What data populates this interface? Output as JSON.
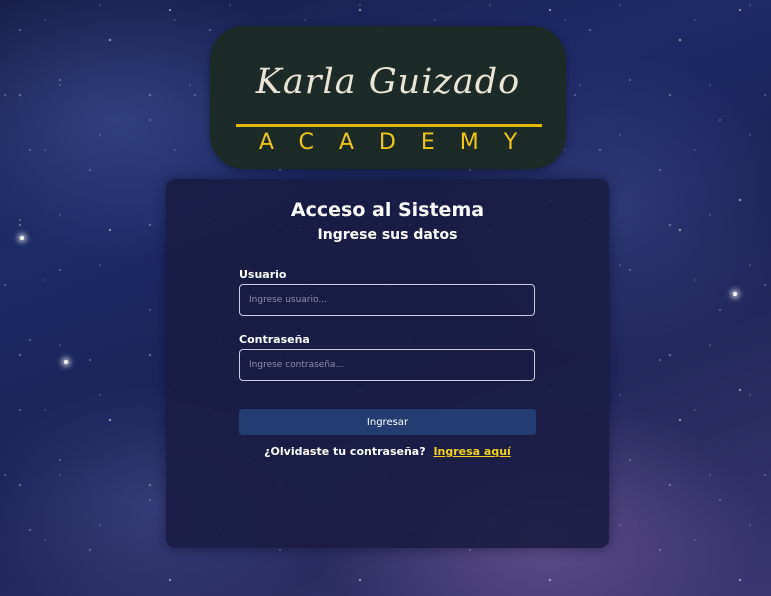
{
  "logo": {
    "script_text": "Karla Guizado",
    "subtitle_text": "ACADEMY",
    "background_color": "#1d2b28",
    "accent_color": "#f0c419"
  },
  "login": {
    "title": "Acceso al Sistema",
    "subtitle": "Ingrese sus datos",
    "username_label": "Usuario",
    "username_placeholder": "Ingrese usuario...",
    "username_value": "",
    "password_label": "Contraseña",
    "password_placeholder": "Ingrese contraseña...",
    "password_value": "",
    "submit_label": "Ingresar",
    "submit_color": "#233d73",
    "forgot_text": "¿Olvidaste tu contraseña?",
    "forgot_link": "Ingresa aquí",
    "link_color": "#f3d21f"
  }
}
